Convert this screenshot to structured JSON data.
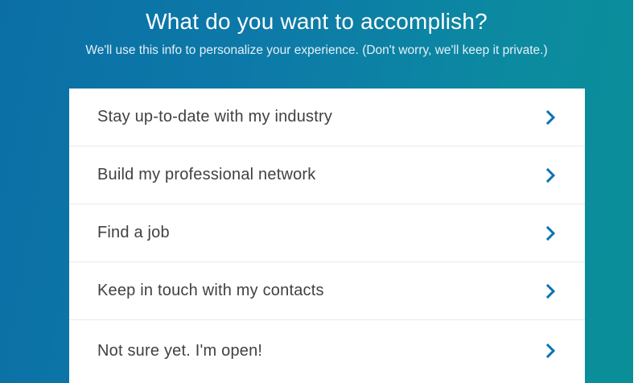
{
  "header": {
    "title": "What do you want to accomplish?",
    "subtitle": "We'll use this info to personalize your experience. (Don't worry, we'll keep it private.)"
  },
  "options": [
    {
      "label": "Stay up-to-date with my industry",
      "icon": "chevron-right-icon"
    },
    {
      "label": "Build my professional network",
      "icon": "chevron-right-icon"
    },
    {
      "label": "Find a job",
      "icon": "chevron-right-icon"
    },
    {
      "label": "Keep in touch with my contacts",
      "icon": "chevron-right-icon"
    },
    {
      "label": "Not sure yet. I'm open!",
      "icon": "chevron-right-icon"
    }
  ],
  "colors": {
    "background_start": "#0b6fa6",
    "background_end": "#0a8f98",
    "chevron": "#0a73b1",
    "option_text": "#3f4144"
  }
}
